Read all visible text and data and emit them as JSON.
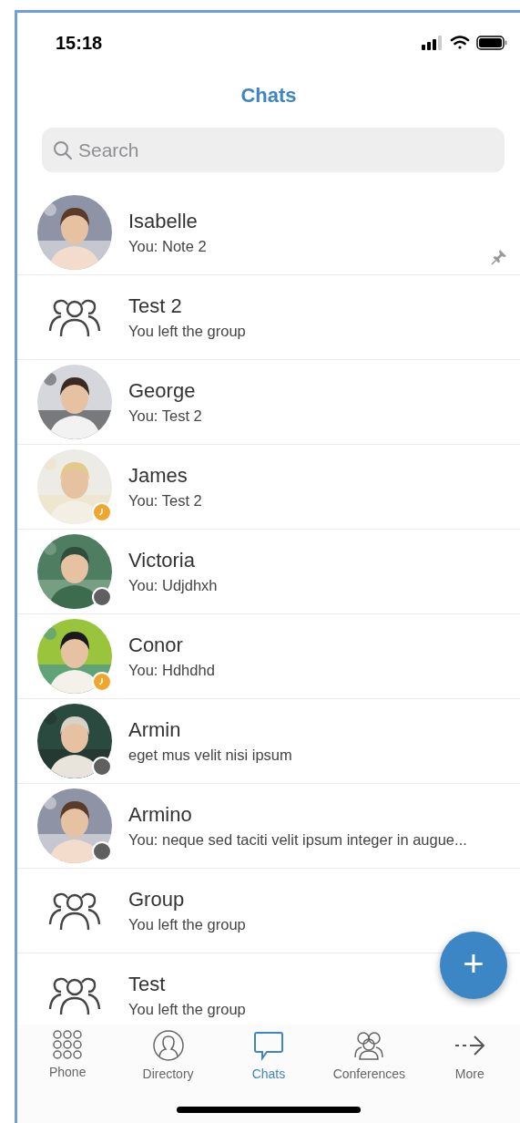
{
  "status_bar": {
    "time": "15:18"
  },
  "header": {
    "title": "Chats"
  },
  "search": {
    "placeholder": "Search"
  },
  "chats": [
    {
      "name": "Isabelle",
      "preview": "You: Note 2",
      "kind": "picture",
      "away": false,
      "offline": false,
      "pinned": true
    },
    {
      "name": "Test 2",
      "preview": "You left the group",
      "kind": "group",
      "away": false,
      "offline": false,
      "pinned": false
    },
    {
      "name": "George",
      "preview": "You: Test 2",
      "kind": "picture",
      "away": false,
      "offline": false,
      "pinned": false
    },
    {
      "name": "James",
      "preview": "You: Test 2",
      "kind": "picture",
      "away": true,
      "offline": false,
      "pinned": false
    },
    {
      "name": "Victoria",
      "preview": "You: Udjdhxh",
      "kind": "picture",
      "away": false,
      "offline": true,
      "pinned": false
    },
    {
      "name": "Conor",
      "preview": "You: Hdhdhd",
      "kind": "picture",
      "away": true,
      "offline": false,
      "pinned": false
    },
    {
      "name": "Armin",
      "preview": "eget mus velit nisi ipsum",
      "kind": "picture",
      "away": false,
      "offline": true,
      "pinned": false
    },
    {
      "name": "Armino",
      "preview": "You: neque sed taciti velit ipsum integer in augue...",
      "kind": "picture",
      "away": false,
      "offline": true,
      "pinned": false
    },
    {
      "name": "Group",
      "preview": "You left the group",
      "kind": "group",
      "away": false,
      "offline": false,
      "pinned": false
    },
    {
      "name": "Test",
      "preview": "You left the group",
      "kind": "group",
      "away": false,
      "offline": false,
      "pinned": false
    }
  ],
  "fab": {
    "label": "+"
  },
  "tabs": [
    {
      "label": "Phone",
      "selected": false
    },
    {
      "label": "Directory",
      "selected": false
    },
    {
      "label": "Chats",
      "selected": true
    },
    {
      "label": "Conferences",
      "selected": false
    },
    {
      "label": "More",
      "selected": false
    }
  ]
}
